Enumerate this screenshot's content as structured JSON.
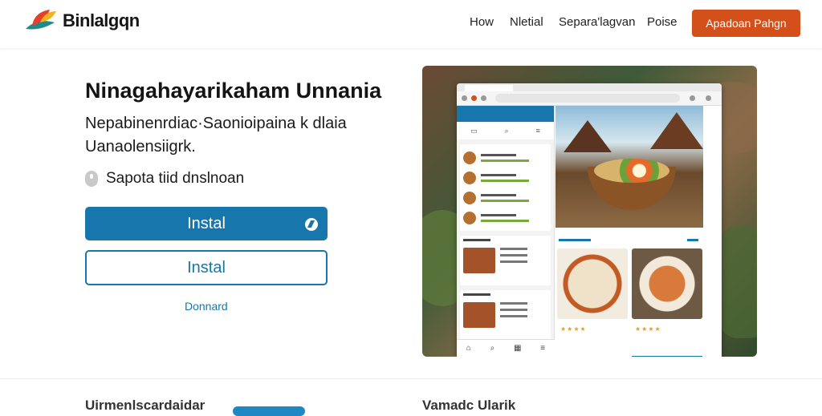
{
  "header": {
    "logo_text": "Binlalgqn",
    "nav": [
      "How",
      "Nletial",
      "Separa'lagvan",
      "Poise"
    ],
    "cta_label": "Apadoan Pahgn"
  },
  "hero": {
    "title": "Ninagahayarikaham Unnania",
    "subtitle": "Nepabinenrdiac·Saonioipaina k dlaia Uanaolensiigrk.",
    "feature_text": "Sapota tiid dnslnoan",
    "primary_button_label": "Instal",
    "outline_button_label": "Instal",
    "link_text": "Donnard"
  },
  "bottom": {
    "left_heading": "Uirmenlscardaidar",
    "right_heading": "Vamadc Ularik"
  },
  "colors": {
    "accent_blue": "#1777ac",
    "cta_orange": "#d4501a"
  },
  "icons": [
    "logo-icon",
    "info-icon",
    "play-icon",
    "home-icon",
    "search-icon",
    "menu-icon"
  ]
}
